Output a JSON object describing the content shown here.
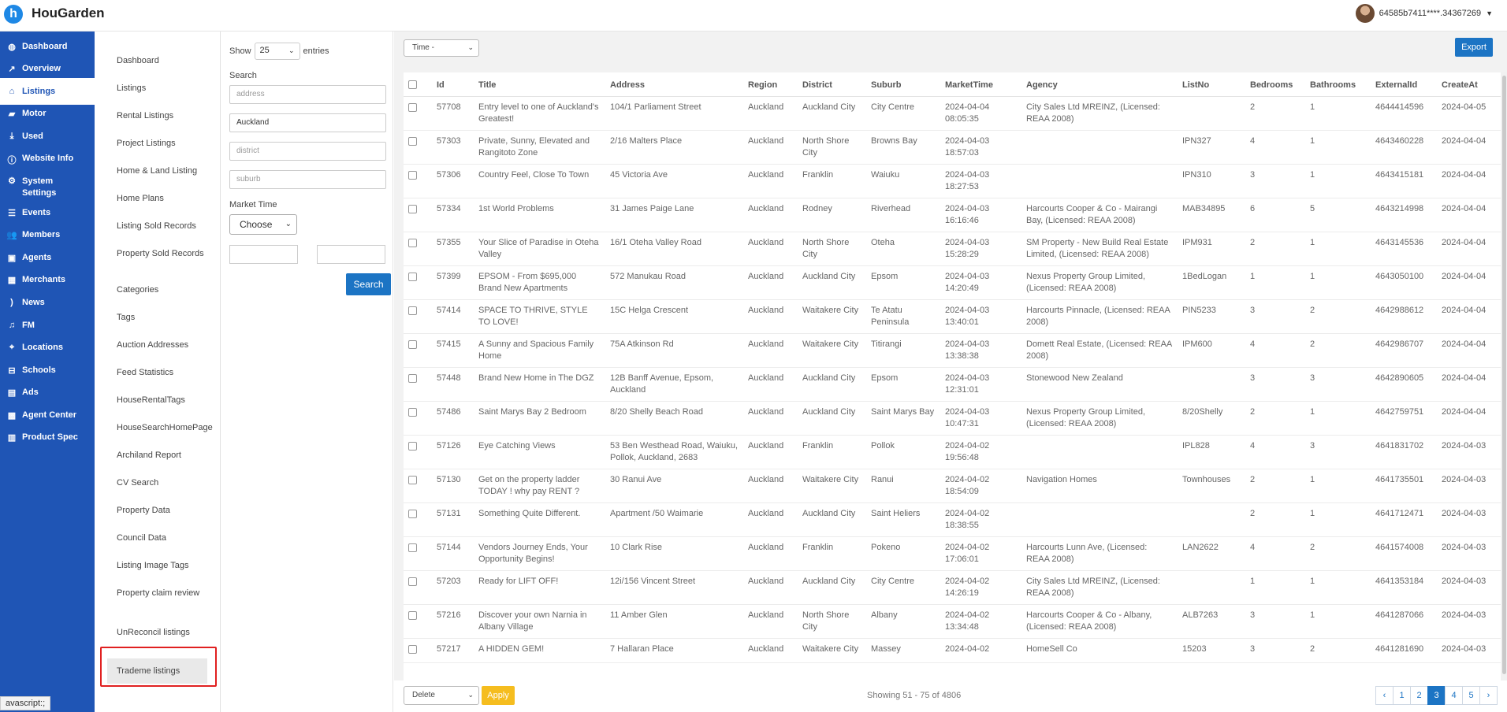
{
  "app": {
    "brand": "HouGarden",
    "logo_letter": "h",
    "user_label": "64585b7411****.34367269"
  },
  "sidebar": {
    "items": [
      {
        "label": "Dashboard",
        "icon": "dashboard-icon",
        "glyph": "◍"
      },
      {
        "label": "Overview",
        "icon": "chart-line-icon",
        "glyph": "↗"
      },
      {
        "label": "Listings",
        "icon": "home-icon",
        "glyph": "⌂",
        "active": true
      },
      {
        "label": "Motor",
        "icon": "car-icon",
        "glyph": "▰"
      },
      {
        "label": "Used",
        "icon": "download-icon",
        "glyph": "⤓"
      },
      {
        "label": "Website Info",
        "icon": "info-icon",
        "glyph": "ⓘ"
      },
      {
        "label": "System\nSettings",
        "icon": "gear-icon",
        "glyph": "⚙"
      },
      {
        "label": "Events",
        "icon": "list-icon",
        "glyph": "☰"
      },
      {
        "label": "Members",
        "icon": "users-icon",
        "glyph": "👥"
      },
      {
        "label": "Agents",
        "icon": "id-card-icon",
        "glyph": "▣"
      },
      {
        "label": "Merchants",
        "icon": "building-icon",
        "glyph": "▦"
      },
      {
        "label": "News",
        "icon": "rss-icon",
        "glyph": ")"
      },
      {
        "label": "FM",
        "icon": "music-icon",
        "glyph": "♫"
      },
      {
        "label": "Locations",
        "icon": "map-marker-icon",
        "glyph": "⌖"
      },
      {
        "label": "Schools",
        "icon": "school-icon",
        "glyph": "⊟"
      },
      {
        "label": "Ads",
        "icon": "ad-icon",
        "glyph": "▤"
      },
      {
        "label": "Agent Center",
        "icon": "agent-center-icon",
        "glyph": "▩"
      },
      {
        "label": "Product Spec",
        "icon": "spec-icon",
        "glyph": "▥"
      }
    ]
  },
  "subnav": {
    "items": [
      "Dashboard",
      "Listings",
      "Rental Listings",
      "Project Listings",
      "Home & Land Listing",
      "Home Plans",
      "Listing Sold Records",
      "Property Sold Records",
      "Categories",
      "Tags",
      "Auction Addresses",
      "Feed Statistics",
      "HouseRentalTags",
      "HouseSearchHomePage",
      "Archiland Report",
      "CV Search",
      "Property Data",
      "Council Data",
      "Listing Image Tags",
      "Property claim review",
      "UnReconcil listings",
      "Trademe listings"
    ]
  },
  "filter": {
    "show_label": "Show",
    "show_value": "25",
    "entries_label": "entries",
    "search_label": "Search",
    "address_placeholder": "address",
    "region_value": "Auckland",
    "district_placeholder": "district",
    "suburb_placeholder": "suburb",
    "market_time_label": "Market Time",
    "market_time_value": "Choose",
    "search_button": "Search"
  },
  "toolbar": {
    "time_select": "Time -",
    "export_label": "Export"
  },
  "table": {
    "columns": [
      "Id",
      "Title",
      "Address",
      "Region",
      "District",
      "Suburb",
      "MarketTime",
      "Agency",
      "ListNo",
      "Bedrooms",
      "Bathrooms",
      "ExternalId",
      "CreateAt"
    ],
    "rows": [
      {
        "id": "57708",
        "title": "Entry level to one of Auckland's Greatest!",
        "address": "104/1 Parliament Street",
        "region": "Auckland",
        "district": "Auckland City",
        "suburb": "City Centre",
        "market_time": "2024-04-04 08:05:35",
        "agency": "City Sales Ltd MREINZ, (Licensed: REAA 2008)",
        "list_no": "",
        "bedrooms": "2",
        "bathrooms": "1",
        "external_id": "4644414596",
        "create_at": "2024-04-05"
      },
      {
        "id": "57303",
        "title": "Private, Sunny, Elevated and Rangitoto Zone",
        "address": "2/16 Malters Place",
        "region": "Auckland",
        "district": "North Shore City",
        "suburb": "Browns Bay",
        "market_time": "2024-04-03 18:57:03",
        "agency": "",
        "list_no": "IPN327",
        "bedrooms": "4",
        "bathrooms": "1",
        "external_id": "4643460228",
        "create_at": "2024-04-04"
      },
      {
        "id": "57306",
        "title": "Country Feel, Close To Town",
        "address": "45 Victoria Ave",
        "region": "Auckland",
        "district": "Franklin",
        "suburb": "Waiuku",
        "market_time": "2024-04-03 18:27:53",
        "agency": "",
        "list_no": "IPN310",
        "bedrooms": "3",
        "bathrooms": "1",
        "external_id": "4643415181",
        "create_at": "2024-04-04"
      },
      {
        "id": "57334",
        "title": "1st World Problems",
        "address": "31 James Paige Lane",
        "region": "Auckland",
        "district": "Rodney",
        "suburb": "Riverhead",
        "market_time": "2024-04-03 16:16:46",
        "agency": "Harcourts Cooper & Co - Mairangi Bay, (Licensed: REAA 2008)",
        "list_no": "MAB34895",
        "bedrooms": "6",
        "bathrooms": "5",
        "external_id": "4643214998",
        "create_at": "2024-04-04"
      },
      {
        "id": "57355",
        "title": "Your Slice of Paradise in Oteha Valley",
        "address": "16/1 Oteha Valley Road",
        "region": "Auckland",
        "district": "North Shore City",
        "suburb": "Oteha",
        "market_time": "2024-04-03 15:28:29",
        "agency": "SM Property - New Build Real Estate Limited, (Licensed: REAA 2008)",
        "list_no": "IPM931",
        "bedrooms": "2",
        "bathrooms": "1",
        "external_id": "4643145536",
        "create_at": "2024-04-04"
      },
      {
        "id": "57399",
        "title": "EPSOM - From $695,000 Brand New Apartments",
        "address": "572 Manukau Road",
        "region": "Auckland",
        "district": "Auckland City",
        "suburb": "Epsom",
        "market_time": "2024-04-03 14:20:49",
        "agency": "Nexus Property Group Limited, (Licensed: REAA 2008)",
        "list_no": "1BedLogan",
        "bedrooms": "1",
        "bathrooms": "1",
        "external_id": "4643050100",
        "create_at": "2024-04-04"
      },
      {
        "id": "57414",
        "title": "SPACE TO THRIVE, STYLE TO LOVE!",
        "address": "15C Helga Crescent",
        "region": "Auckland",
        "district": "Waitakere City",
        "suburb": "Te Atatu Peninsula",
        "market_time": "2024-04-03 13:40:01",
        "agency": "Harcourts Pinnacle, (Licensed: REAA 2008)",
        "list_no": "PIN5233",
        "bedrooms": "3",
        "bathrooms": "2",
        "external_id": "4642988612",
        "create_at": "2024-04-04"
      },
      {
        "id": "57415",
        "title": "A Sunny and Spacious Family Home",
        "address": "75A Atkinson Rd",
        "region": "Auckland",
        "district": "Waitakere City",
        "suburb": "Titirangi",
        "market_time": "2024-04-03 13:38:38",
        "agency": "Domett Real Estate, (Licensed: REAA 2008)",
        "list_no": "IPM600",
        "bedrooms": "4",
        "bathrooms": "2",
        "external_id": "4642986707",
        "create_at": "2024-04-04"
      },
      {
        "id": "57448",
        "title": "Brand New Home in The DGZ",
        "address": "12B Banff Avenue, Epsom, Auckland",
        "region": "Auckland",
        "district": "Auckland City",
        "suburb": "Epsom",
        "market_time": "2024-04-03 12:31:01",
        "agency": "Stonewood New Zealand",
        "list_no": "",
        "bedrooms": "3",
        "bathrooms": "3",
        "external_id": "4642890605",
        "create_at": "2024-04-04"
      },
      {
        "id": "57486",
        "title": "Saint Marys Bay 2 Bedroom",
        "address": "8/20 Shelly Beach Road",
        "region": "Auckland",
        "district": "Auckland City",
        "suburb": "Saint Marys Bay",
        "market_time": "2024-04-03 10:47:31",
        "agency": "Nexus Property Group Limited, (Licensed: REAA 2008)",
        "list_no": "8/20Shelly",
        "bedrooms": "2",
        "bathrooms": "1",
        "external_id": "4642759751",
        "create_at": "2024-04-04"
      },
      {
        "id": "57126",
        "title": "Eye Catching Views",
        "address": "53 Ben Westhead Road, Waiuku, Pollok, Auckland, 2683",
        "region": "Auckland",
        "district": "Franklin",
        "suburb": "Pollok",
        "market_time": "2024-04-02 19:56:48",
        "agency": "",
        "list_no": "IPL828",
        "bedrooms": "4",
        "bathrooms": "3",
        "external_id": "4641831702",
        "create_at": "2024-04-03"
      },
      {
        "id": "57130",
        "title": "Get on the property ladder TODAY ! why pay RENT ?",
        "address": "30 Ranui Ave",
        "region": "Auckland",
        "district": "Waitakere City",
        "suburb": "Ranui",
        "market_time": "2024-04-02 18:54:09",
        "agency": "Navigation Homes",
        "list_no": "Townhouses",
        "bedrooms": "2",
        "bathrooms": "1",
        "external_id": "4641735501",
        "create_at": "2024-04-03"
      },
      {
        "id": "57131",
        "title": "Something Quite Different.",
        "address": "Apartment /50 Waimarie",
        "region": "Auckland",
        "district": "Auckland City",
        "suburb": "Saint Heliers",
        "market_time": "2024-04-02 18:38:55",
        "agency": "",
        "list_no": "",
        "bedrooms": "2",
        "bathrooms": "1",
        "external_id": "4641712471",
        "create_at": "2024-04-03"
      },
      {
        "id": "57144",
        "title": "Vendors Journey Ends, Your Opportunity Begins!",
        "address": "10 Clark Rise",
        "region": "Auckland",
        "district": "Franklin",
        "suburb": "Pokeno",
        "market_time": "2024-04-02 17:06:01",
        "agency": "Harcourts Lunn Ave, (Licensed: REAA 2008)",
        "list_no": "LAN2622",
        "bedrooms": "4",
        "bathrooms": "2",
        "external_id": "4641574008",
        "create_at": "2024-04-03"
      },
      {
        "id": "57203",
        "title": "Ready for LIFT OFF!",
        "address": "12i/156 Vincent Street",
        "region": "Auckland",
        "district": "Auckland City",
        "suburb": "City Centre",
        "market_time": "2024-04-02 14:26:19",
        "agency": "City Sales Ltd MREINZ, (Licensed: REAA 2008)",
        "list_no": "",
        "bedrooms": "1",
        "bathrooms": "1",
        "external_id": "4641353184",
        "create_at": "2024-04-03"
      },
      {
        "id": "57216",
        "title": "Discover your own Narnia in Albany Village",
        "address": "11 Amber Glen",
        "region": "Auckland",
        "district": "North Shore City",
        "suburb": "Albany",
        "market_time": "2024-04-02 13:34:48",
        "agency": "Harcourts Cooper & Co - Albany, (Licensed: REAA 2008)",
        "list_no": "ALB7263",
        "bedrooms": "3",
        "bathrooms": "1",
        "external_id": "4641287066",
        "create_at": "2024-04-03"
      },
      {
        "id": "57217",
        "title": "A HIDDEN GEM!",
        "address": "7 Hallaran Place",
        "region": "Auckland",
        "district": "Waitakere City",
        "suburb": "Massey",
        "market_time": "2024-04-02",
        "agency": "HomeSell Co",
        "list_no": "15203",
        "bedrooms": "3",
        "bathrooms": "2",
        "external_id": "4641281690",
        "create_at": "2024-04-03"
      }
    ]
  },
  "bottom": {
    "bulk_action": "Delete",
    "apply_label": "Apply",
    "showing_text": "Showing 51 - 75 of 4806",
    "pages": [
      "‹",
      "1",
      "2",
      "3",
      "4",
      "5",
      "›"
    ],
    "active_page": "3"
  },
  "status_tip": "avascript:;"
}
